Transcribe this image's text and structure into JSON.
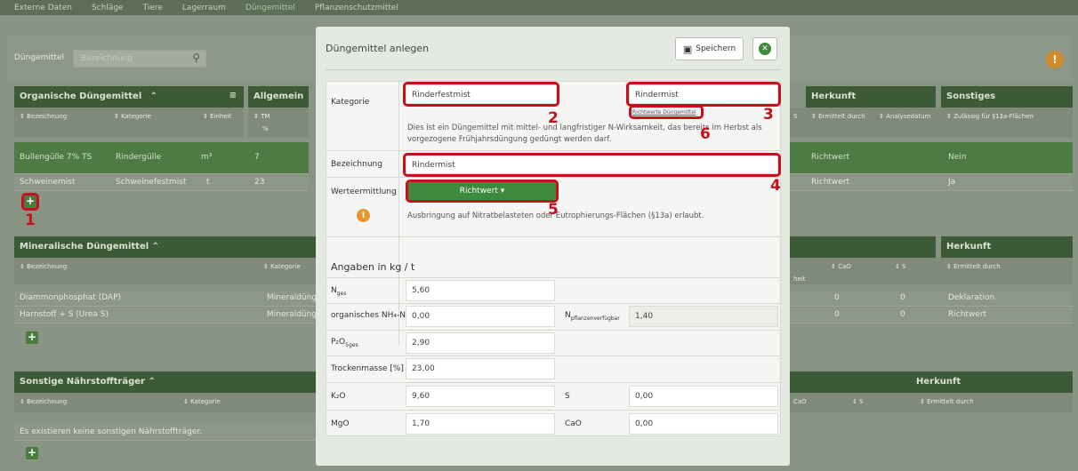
{
  "topnav": [
    "Externe Daten",
    "Schläge",
    "Tiere",
    "Lagerraum",
    "Düngemittel",
    "Pflanzenschutzmittel"
  ],
  "filter": {
    "label": "Düngemittel",
    "placeholder": "Bezeichnung"
  },
  "organic": {
    "title": "Organische Düngemittel",
    "col_bezeichnung": "Bezeichnung",
    "col_kategorie": "Kategorie",
    "col_einheit": "Einheit",
    "col_allgemein": "Allgemein",
    "col_tm": "TM",
    "col_tm_unit": "%",
    "rows": [
      {
        "bez": "Bullengülle 7% TS",
        "kat": "Rindergülle",
        "einh": "m³",
        "tm": "7"
      },
      {
        "bez": "Schweinemist",
        "kat": "Schweinefestmist",
        "einh": "t",
        "tm": "23"
      }
    ]
  },
  "organic_right": {
    "herkunft": "Herkunft",
    "sonstiges": "Sonstiges",
    "col_s": "S",
    "col_ermittelt": "Ermittelt durch",
    "col_analysedatum": "Analysedatum",
    "col_zulaessig": "Zulässig für §13a-Flächen",
    "rows": [
      {
        "herk": "Richtwert",
        "sonst": "Nein"
      },
      {
        "herk": "Richtwert",
        "sonst": "Ja"
      }
    ]
  },
  "mineral": {
    "title": "Mineralische Düngemittel",
    "col_bezeichnung": "Bezeichnung",
    "col_kategorie": "Kategorie",
    "rows": [
      {
        "bez": "Diammonphosphat (DAP)",
        "kat": "Mineraldüng"
      },
      {
        "bez": "Harnstoff + S (Urea S)",
        "kat": "Mineraldüng"
      }
    ]
  },
  "mineral_right": {
    "herkunft": "Herkunft",
    "col_einheit": "heit",
    "col_cao": "CaO",
    "col_s": "S",
    "col_ermittelt": "Ermittelt durch",
    "rows": [
      {
        "cao": "0",
        "s": "0",
        "herk": "Deklaration"
      },
      {
        "cao": "0",
        "s": "0",
        "herk": "Richtwert"
      }
    ]
  },
  "sonstige": {
    "title": "Sonstige Nährstoffträger",
    "col_bezeichnung": "Bezeichnung",
    "col_kategorie": "Kategorie",
    "empty": "Es existieren keine sonstigen Nährstoffträger."
  },
  "sonstige_right": {
    "herkunft": "Herkunft",
    "col_cao": "CaO",
    "col_s": "S",
    "col_ermittelt": "Ermittelt durch"
  },
  "modal": {
    "title": "Düngemittel anlegen",
    "save": "Speichern",
    "kategorie_label": "Kategorie",
    "kategorie_value": "Rinderfestmist",
    "subkategorie_value": "Rindermist",
    "richtwerte_link": "Richtwerte Düngemittel",
    "info_text": "Dies ist ein Düngemittel mit mittel- und langfristiger N-Wirksamkeit, das bereits im Herbst als vorgezogene Frühjahrsdüngung gedüngt werden darf.",
    "bezeichnung_label": "Bezeichnung",
    "bezeichnung_value": "Rindermist",
    "werteermittlung_label": "Werteermittlung",
    "werteermittlung_value": "Richtwert",
    "ausbringung_text": "Ausbringung auf Nitratbelasteten oder Eutrophierungs-Flächen (§13a) erlaubt.",
    "angaben": "Angaben in kg / t",
    "nges_label": "N",
    "nges_sub": "ges",
    "nges_value": "5,60",
    "nh4_label": "organisches NH₄-N",
    "nh4_value": "0,00",
    "npfl_label": "N",
    "npfl_sub": "pflanzenverfügbar",
    "npfl_value": "1,40",
    "p2o5_label": "P₂O",
    "p2o5_sub": "5ges",
    "p2o5_value": "2,90",
    "tm_label": "Trockenmasse [%]",
    "tm_value": "23,00",
    "k2o_label": "K₂O",
    "k2o_value": "9,60",
    "s_label": "S",
    "s_value": "0,00",
    "mgo_label": "MgO",
    "mgo_value": "1,70",
    "cao_label": "CaO",
    "cao_value": "0,00"
  },
  "annotations": [
    "1",
    "2",
    "3",
    "4",
    "5",
    "6"
  ]
}
